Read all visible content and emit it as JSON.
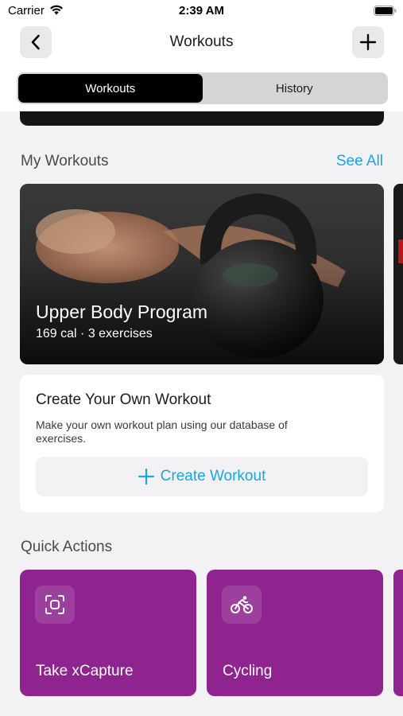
{
  "status_bar": {
    "carrier": "Carrier",
    "time": "2:39 AM",
    "icons": [
      "wifi-icon",
      "battery-icon"
    ]
  },
  "nav": {
    "title": "Workouts",
    "back_icon": "chevron-left-icon",
    "add_icon": "plus-icon"
  },
  "segments": [
    {
      "label": "Workouts",
      "active": true
    },
    {
      "label": "History",
      "active": false
    }
  ],
  "my_workouts": {
    "title": "My Workouts",
    "see_all": "See All",
    "card": {
      "title": "Upper Body Program",
      "subtitle": "169 cal · 3 exercises"
    }
  },
  "create_card": {
    "title": "Create Your Own Workout",
    "description": "Make your own workout plan using our database of exercises.",
    "button_label": "Create Workout",
    "button_icon": "plus-icon"
  },
  "quick_actions": {
    "title": "Quick Actions",
    "items": [
      {
        "label": "Take xCapture",
        "icon": "scan-icon"
      },
      {
        "label": "Cycling",
        "icon": "cycling-icon"
      }
    ]
  },
  "colors": {
    "accent": "#1aa6e6",
    "quick_action_bg": "#8f2390",
    "segment_active_bg": "#000000"
  }
}
